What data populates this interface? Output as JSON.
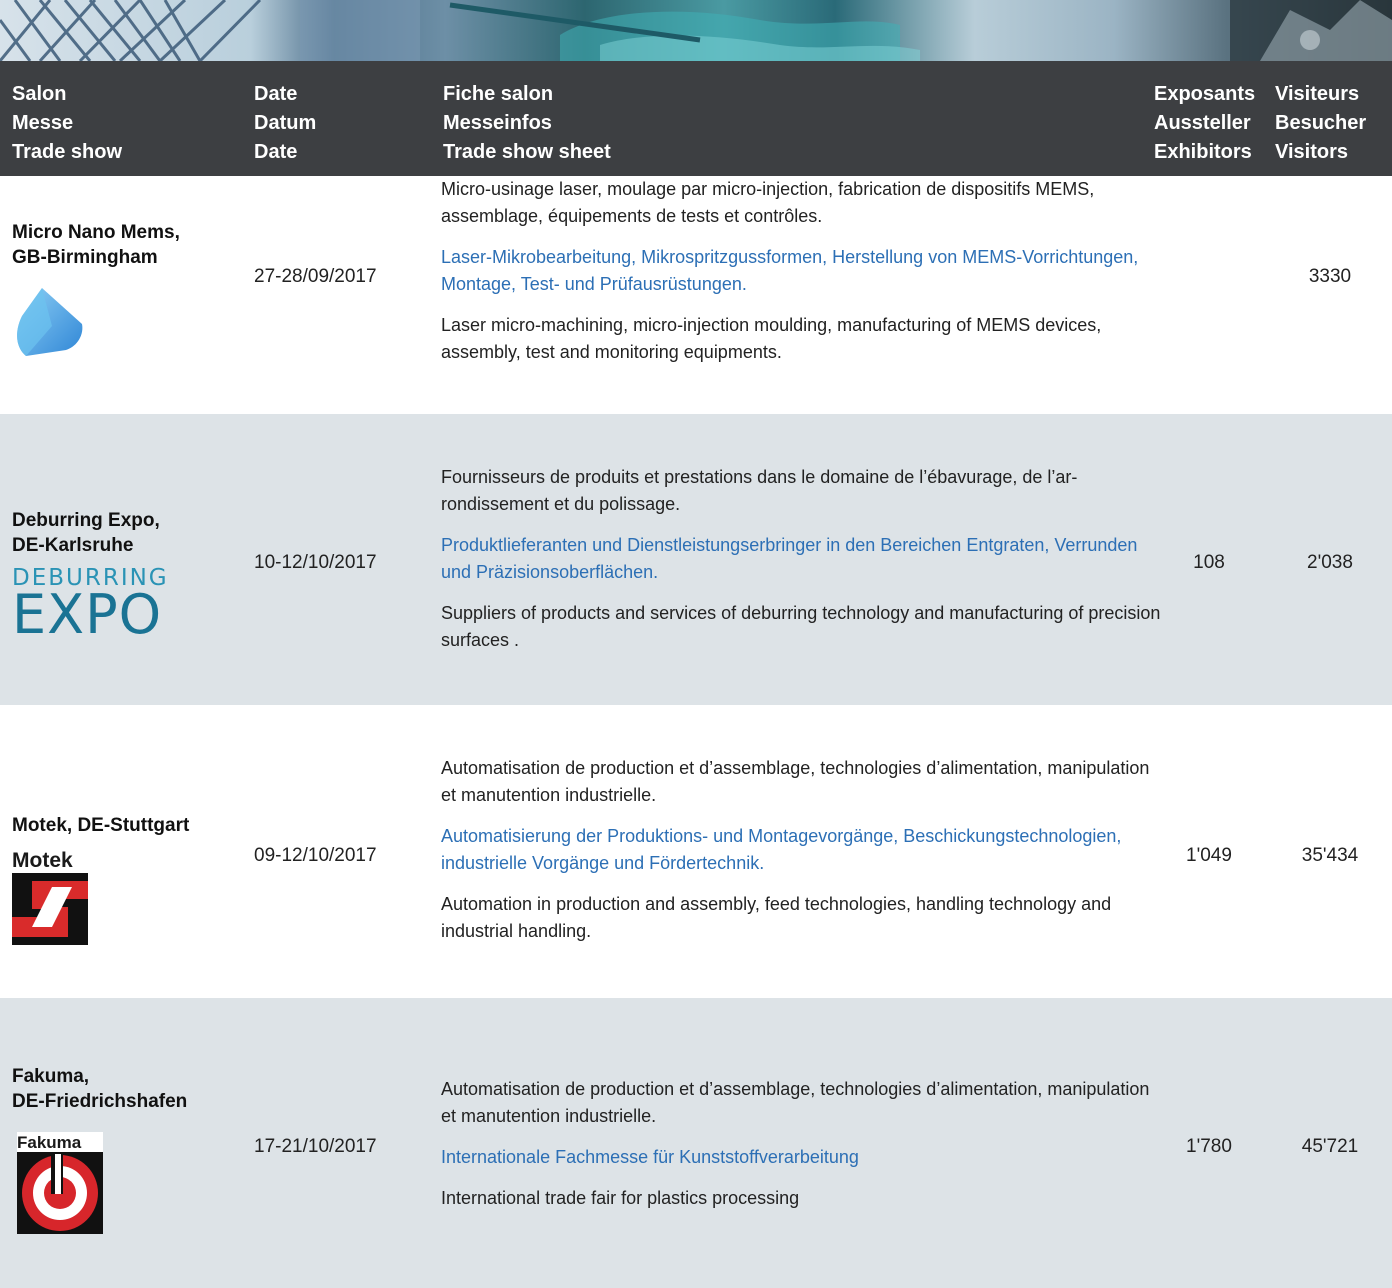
{
  "header": {
    "col_show": [
      "Salon",
      "Messe",
      "Trade show"
    ],
    "col_date": [
      "Date",
      "Datum",
      "Date"
    ],
    "col_sheet": [
      "Fiche salon",
      "Messeinfos",
      "Trade show sheet"
    ],
    "col_exhibitors": [
      "Exposants",
      "Aussteller",
      "Exhibitors"
    ],
    "col_visitors": [
      "Visiteurs",
      "Besucher",
      "Visitors"
    ]
  },
  "rows": [
    {
      "name_line1": "Micro Nano Mems,",
      "name_line2": "GB-Birmingham",
      "date": "27-28/09/2017",
      "fr": "Micro-usinage laser, moulage par micro-injection, fabrication de dispositifs MEMS, assemblage, équipements de tests et contrôles.",
      "de": "Laser-Mikrobearbeitung, Mikrospritzgussformen, Herstellung von MEMS-Vorrichtungen, Montage, Test- und Prüfausrüstungen.",
      "en": "Laser micro-machining, micro-injection moulding, manufacturing of MEMS devices, assembly, test and monitoring equipments.",
      "exhibitors": "",
      "visitors": "3330"
    },
    {
      "name_line1": "Deburring Expo,",
      "name_line2": "DE-Karlsruhe",
      "logo_text_top": "DEBURRING",
      "logo_text_bottom": "EXPO",
      "date": "10-12/10/2017",
      "fr": "Fournisseurs de produits et prestations dans le domaine de l’ébavurage, de l’ar-rondissement et du polissage.",
      "de": "Produktlieferanten und Dienstleistungserbringer in den Bereichen Entgraten, Verrunden und Präzisionsoberflächen.",
      "en": "Suppliers of products and services of deburring technology and manufacturing of precision surfaces .",
      "exhibitors": "108",
      "visitors": "2'038"
    },
    {
      "name_line1": "Motek, DE-Stuttgart",
      "name_line2": "",
      "logo_text": "Motek",
      "date": "09-12/10/2017",
      "fr": "Automatisation de production et d’assemblage, technologies d’alimentation, manipulation et manutention industrielle.",
      "de": "Automatisierung der Produktions- und Montagevorgänge, Beschickungstechnologien, industrielle Vorgänge und Fördertechnik.",
      "en": "Automation in production and assembly, feed technologies, handling technology and industrial handling.",
      "exhibitors": "1'049",
      "visitors": "35'434"
    },
    {
      "name_line1": "Fakuma,",
      "name_line2": "DE-Friedrichshafen",
      "logo_text": "Fakuma",
      "date": "17-21/10/2017",
      "fr": "Automatisation de production et d’assemblage, technologies d’alimentation, manipulation et manutention industrielle.",
      "de": "Internationale Fachmesse für Kunststoffverarbeitung",
      "en": "International trade fair for plastics processing",
      "exhibitors": "1'780",
      "visitors": "45'721"
    }
  ]
}
